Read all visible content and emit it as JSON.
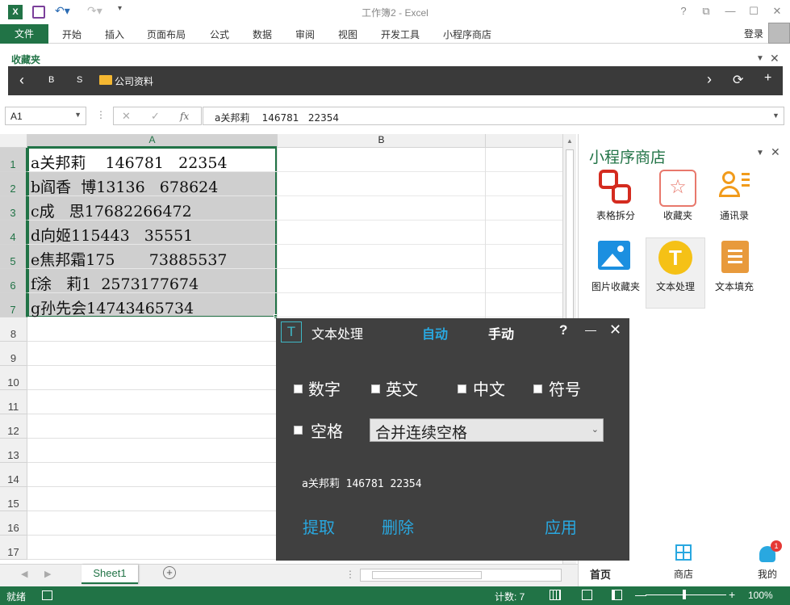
{
  "window": {
    "title": "工作簿2 - Excel",
    "help": "?",
    "restore": "⧉",
    "minimize": "—",
    "maximize": "☐",
    "close": "✕"
  },
  "ribbon": {
    "file": "文件",
    "tabs": [
      "开始",
      "插入",
      "页面布局",
      "公式",
      "数据",
      "审阅",
      "视图",
      "开发工具",
      "小程序商店"
    ],
    "login": "登录"
  },
  "favorites": {
    "title": "收藏夹",
    "back": "‹",
    "b": "B",
    "s": "S",
    "folder": "公司资料",
    "next": "›",
    "refresh": "⟳",
    "add": "+"
  },
  "formula_bar": {
    "name_box": "A1",
    "fx": "fx",
    "formula": "a关邦莉    146781   22354"
  },
  "grid": {
    "columns": [
      "A",
      "B"
    ],
    "rows": [
      "1",
      "2",
      "3",
      "4",
      "5",
      "6",
      "7",
      "8",
      "9",
      "10",
      "11",
      "12",
      "13",
      "14",
      "15",
      "16",
      "17"
    ],
    "cells": [
      "a关邦莉    146781   22354",
      "b阎香  博13136   678624",
      "c成   思17682266472",
      "d向姬115443   35551",
      "e焦邦霜175       73885537",
      "f涂   莉1  2573177674",
      "g孙先会14743465734"
    ]
  },
  "side_panel": {
    "title": "小程序商店",
    "apps": [
      "表格拆分",
      "收藏夹",
      "通讯录",
      "图片收藏夹",
      "文本处理",
      "文本填充"
    ],
    "nav": [
      "首页",
      "商店",
      "我的"
    ],
    "badge": "1"
  },
  "dialog": {
    "icon": "T",
    "title": "文本处理",
    "mode_auto": "自动",
    "mode_manual": "手动",
    "help": "?",
    "minimize": "—",
    "close": "✕",
    "options": [
      "数字",
      "英文",
      "中文",
      "符号"
    ],
    "space_label": "空格",
    "space_select": "合并连续空格",
    "preview": "a关邦莉 146781 22354",
    "actions": [
      "提取",
      "删除",
      "应用"
    ]
  },
  "sheets": {
    "active": "Sheet1",
    "add": "+"
  },
  "status": {
    "ready": "就绪",
    "count": "计数: 7",
    "zoom": "100%"
  },
  "colors": {
    "accent": "#217346",
    "dialog_bg": "#404040",
    "link": "#29a8e0"
  }
}
